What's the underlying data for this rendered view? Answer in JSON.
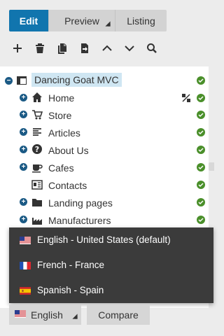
{
  "modes": {
    "edit": "Edit",
    "preview": "Preview",
    "listing": "Listing"
  },
  "toolbar": {
    "icons": [
      "plus-icon",
      "trash-icon",
      "copy-icon",
      "move-icon",
      "chevron-up-icon",
      "chevron-down-icon",
      "search-icon"
    ]
  },
  "tree": {
    "root": "Dancing Goat MVC",
    "items": [
      {
        "label": "Home",
        "icon": "home-icon"
      },
      {
        "label": "Store",
        "icon": "cart-icon"
      },
      {
        "label": "Articles",
        "icon": "articles-icon"
      },
      {
        "label": "About Us",
        "icon": "question-icon"
      },
      {
        "label": "Cafes",
        "icon": "coffee-cup-icon"
      },
      {
        "label": "Contacts",
        "icon": "contact-card-icon"
      },
      {
        "label": "Landing pages",
        "icon": "folder-icon"
      },
      {
        "label": "Manufacturers",
        "icon": "factory-icon"
      }
    ]
  },
  "language_menu": {
    "items": [
      {
        "label": "English - United States (default)",
        "flag": "us-flag-icon"
      },
      {
        "label": "French - France",
        "flag": "fr-flag-icon"
      },
      {
        "label": "Spanish - Spain",
        "flag": "es-flag-icon"
      }
    ]
  },
  "footer": {
    "language_button": "English",
    "compare_button": "Compare"
  },
  "colors": {
    "accent": "#1175ae",
    "status_ok": "#4a8f2a",
    "menu_bg": "#3b3b3b"
  }
}
